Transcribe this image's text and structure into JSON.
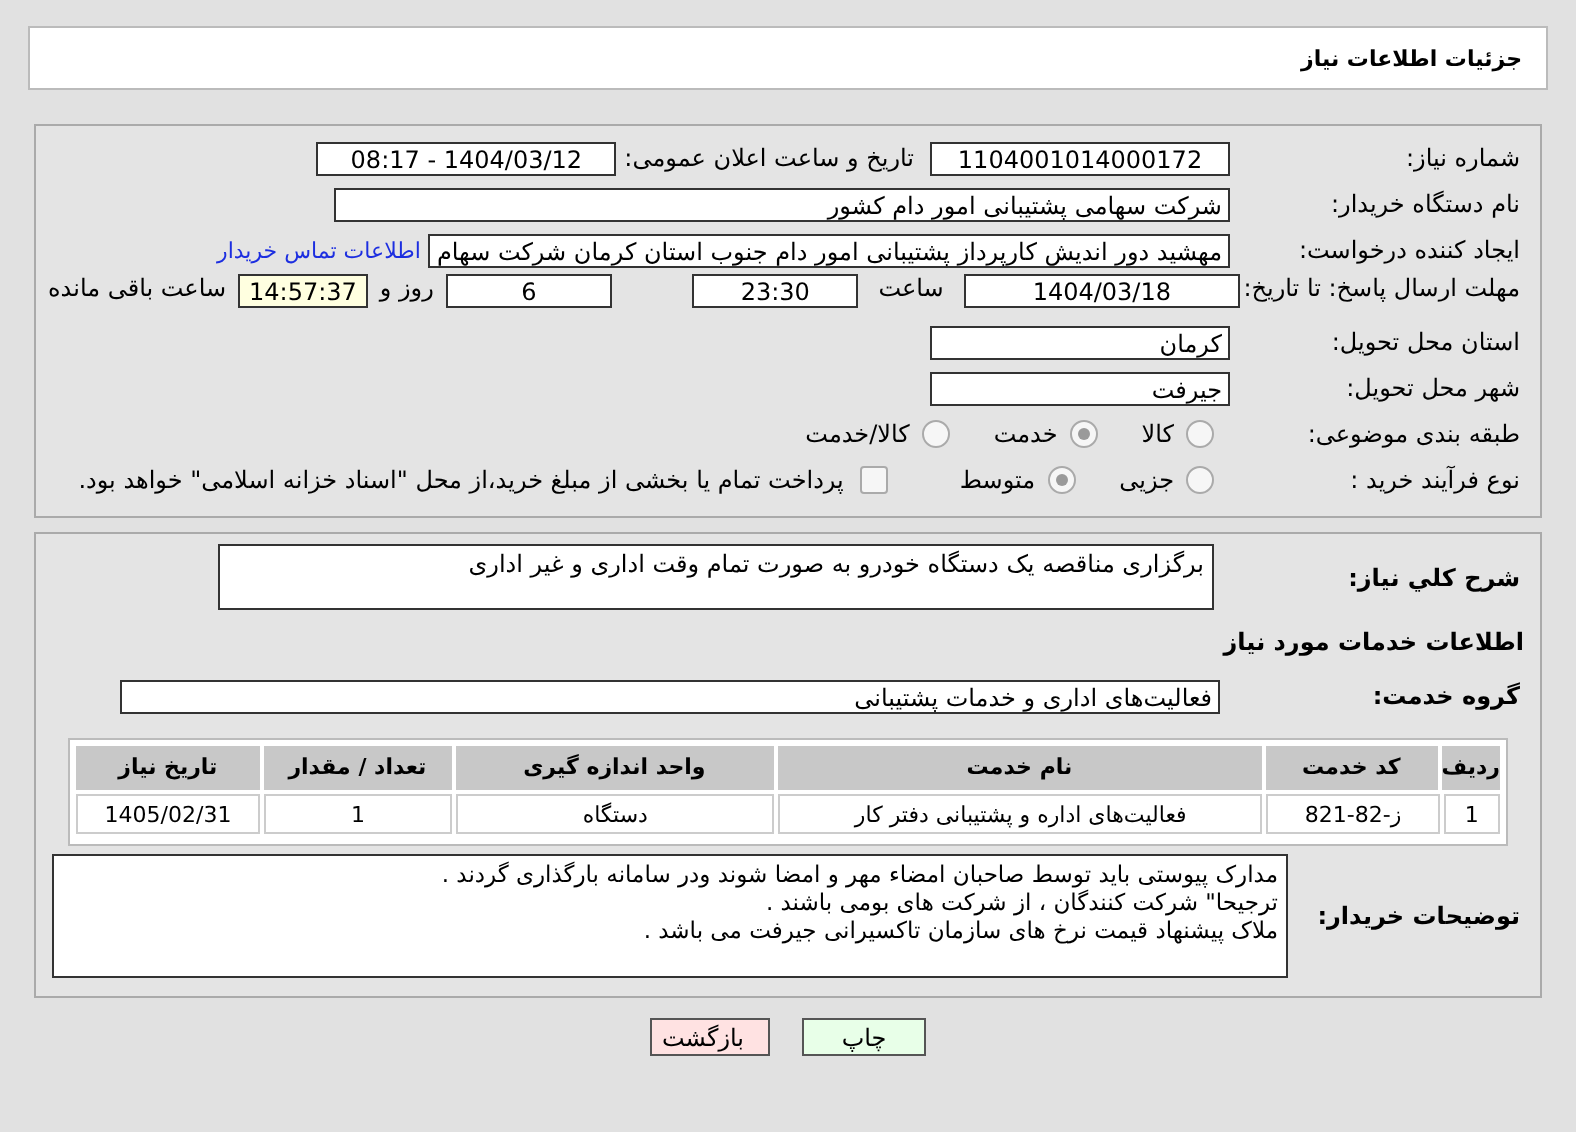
{
  "header": {
    "title": "جزئیات اطلاعات نیاز"
  },
  "need_number": {
    "label": "شماره نیاز:",
    "value": "1104001014000172"
  },
  "announce": {
    "label": "تاریخ و ساعت اعلان عمومی:",
    "value": "1404/03/12 - 08:17"
  },
  "buyer_org": {
    "label": "نام دستگاه خریدار:",
    "value": "شرکت سهامی پشتیبانی امور دام کشور"
  },
  "requester": {
    "label": "ایجاد کننده درخواست:",
    "value": "مهشید دور اندیش کارپرداز پشتیبانی امور دام جنوب استان کرمان شرکت سهام",
    "link": "اطلاعات تماس خریدار"
  },
  "deadline": {
    "label": "مهلت ارسال پاسخ: تا تاریخ:",
    "date": "1404/03/18",
    "time_label": "ساعت",
    "time": "23:30",
    "days": "6",
    "days_label": "روز و",
    "remaining": "14:57:37",
    "remaining_label": "ساعت باقی مانده"
  },
  "province": {
    "label": "استان محل تحویل:",
    "value": "کرمان"
  },
  "city": {
    "label": "شهر محل تحویل:",
    "value": "جیرفت"
  },
  "category": {
    "label": "طبقه بندی موضوعی:",
    "options": [
      {
        "label": "کالا",
        "selected": false
      },
      {
        "label": "خدمت",
        "selected": true
      },
      {
        "label": "کالا/خدمت",
        "selected": false
      }
    ]
  },
  "process": {
    "label": "نوع فرآیند خرید :",
    "options": [
      {
        "label": "جزیی",
        "selected": false
      },
      {
        "label": "متوسط",
        "selected": true
      }
    ],
    "payment": {
      "checked": false,
      "text": "پرداخت تمام یا بخشی از مبلغ خرید،از محل \"اسناد خزانه اسلامی\" خواهد بود."
    }
  },
  "description": {
    "label": "شرح کلي نياز:",
    "value": "برگزاری مناقصه یک دستگاه خودرو به صورت تمام وقت اداری و غیر اداری"
  },
  "services": {
    "title": "اطلاعات خدمات مورد نیاز",
    "group_label": "گروه خدمت:",
    "group_value": "فعالیت‌های اداری و خدمات پشتیبانی",
    "table": {
      "columns": [
        "ردیف",
        "کد خدمت",
        "نام خدمت",
        "واحد اندازه گیری",
        "تعداد / مقدار",
        "تاریخ نیاز"
      ],
      "rows": [
        [
          "1",
          "ز-82-821",
          "فعالیت‌های اداره و پشتیبانی دفتر کار",
          "دستگاه",
          "1",
          "1405/02/31"
        ]
      ]
    }
  },
  "buyer_notes": {
    "label": "توضیحات خریدار:",
    "lines": [
      "مدارک پیوستی باید توسط صاحبان امضاء مهر و امضا شوند ودر سامانه بارگذاری گردند .",
      "ترجیحا\" شرکت کنندگان ، از شرکت های بومی باشند .",
      "ملاک پیشنهاد قیمت نرخ های سازمان تاکسیرانی جیرفت می باشد ."
    ]
  },
  "buttons": [
    {
      "kind": "print",
      "label": "چاپ"
    },
    {
      "kind": "back",
      "label": "بازگشت"
    }
  ]
}
